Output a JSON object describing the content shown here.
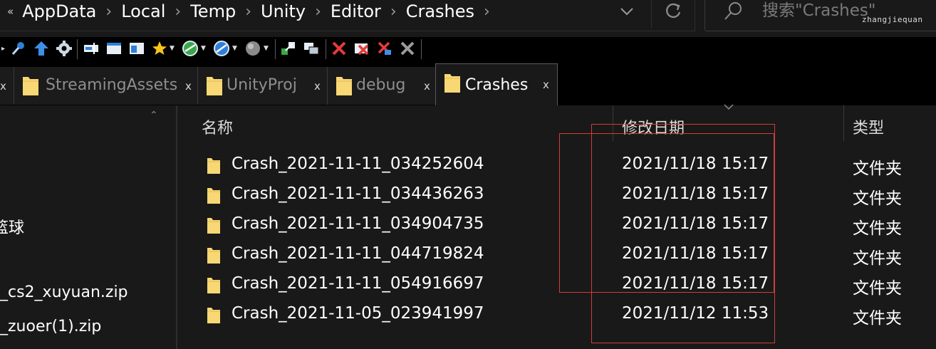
{
  "address_bar": {
    "lead_glyph": "«",
    "crumbs": [
      "AppData",
      "Local",
      "Temp",
      "Unity",
      "Editor",
      "Crashes"
    ],
    "separator": "›",
    "dropdown_icon": "chevron-down-icon",
    "refresh_icon": "refresh-icon"
  },
  "search": {
    "placeholder": "搜索\"Crashes\"",
    "watermark": "zhangjiequan"
  },
  "toolbar": {
    "icons": [
      "pin-icon",
      "up-arrow-icon",
      "gear-icon",
      "rename-icon",
      "view-icon",
      "panel-icon",
      "favorites-star-icon",
      "web-icon",
      "browser-icon",
      "globe-icon",
      "copy-to-icon",
      "windows-icon",
      "delete-icon",
      "delete-close-icon",
      "cut-icon",
      "tools-icon"
    ]
  },
  "tabs": [
    {
      "label": "StreamingAssets",
      "close": "x",
      "active": false
    },
    {
      "label": "UnityProj",
      "close": "x",
      "active": false
    },
    {
      "label": "debug",
      "close": "x",
      "active": false
    },
    {
      "label": "Crashes",
      "close": "x",
      "active": true
    }
  ],
  "nav_pane": {
    "items": [
      "篮球",
      "_cs2_xuyuan.zip",
      "_zuoer(1).zip"
    ]
  },
  "columns": {
    "name": "名称",
    "modified": "修改日期",
    "type": "类型"
  },
  "files": [
    {
      "name": "Crash_2021-11-11_034252604",
      "modified": "2021/11/18 15:17",
      "type": "文件夹"
    },
    {
      "name": "Crash_2021-11-11_034436263",
      "modified": "2021/11/18 15:17",
      "type": "文件夹"
    },
    {
      "name": "Crash_2021-11-11_034904735",
      "modified": "2021/11/18 15:17",
      "type": "文件夹"
    },
    {
      "name": "Crash_2021-11-11_044719824",
      "modified": "2021/11/18 15:17",
      "type": "文件夹"
    },
    {
      "name": "Crash_2021-11-11_054916697",
      "modified": "2021/11/18 15:17",
      "type": "文件夹"
    },
    {
      "name": "Crash_2021-11-05_023941997",
      "modified": "2021/11/12 11:53",
      "type": "文件夹"
    }
  ],
  "colors": {
    "background": "#191919",
    "toolbar": "#000000",
    "folder": "#f8d775",
    "annotation_red": "#d43c3c"
  }
}
